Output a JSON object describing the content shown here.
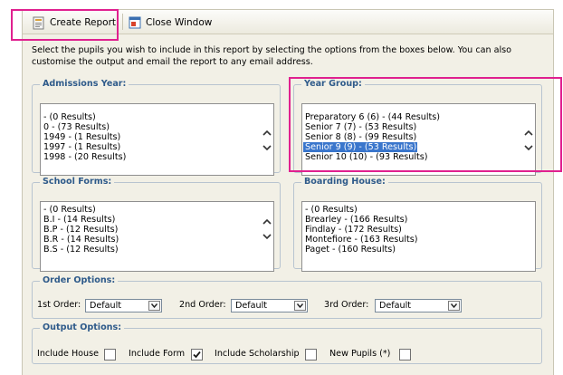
{
  "toolbar": {
    "create_report_label": "Create Report",
    "close_window_label": "Close Window"
  },
  "intro_text": "Select the pupils you wish to include in this report by selecting the options from the boxes below. You can also customise the output and email the report to any email address.",
  "admissions_year": {
    "legend": "Admissions Year:",
    "items": [
      "- (0 Results)",
      "0 - (73 Results)",
      "1949 - (1 Results)",
      "1997 - (1 Results)",
      "1998 - (20 Results)"
    ]
  },
  "year_group": {
    "legend": "Year Group:",
    "items": [
      "Preparatory 6 (6) - (44 Results)",
      "Senior 7 (7) - (53 Results)",
      "Senior 8 (8) - (99 Results)",
      "Senior 9 (9) - (53 Results)",
      "Senior 10 (10) - (93 Results)"
    ],
    "selected": "Senior 9 (9) - (53 Results)"
  },
  "school_forms": {
    "legend": "School Forms:",
    "items": [
      "- (0 Results)",
      "B.I - (14 Results)",
      "B.P - (12 Results)",
      "B.R - (14 Results)",
      "B.S - (12 Results)"
    ]
  },
  "boarding_house": {
    "legend": "Boarding House:",
    "items": [
      "- (0 Results)",
      "Brearley - (166 Results)",
      "Findlay - (172 Results)",
      "Montefiore - (163 Results)",
      "Paget - (160 Results)"
    ]
  },
  "order_options": {
    "legend": "Order Options:",
    "first_label": "1st Order:",
    "first_value": "Default",
    "second_label": "2nd Order:",
    "second_value": "Default",
    "third_label": "3rd Order:",
    "third_value": "Default"
  },
  "output_options": {
    "legend": "Output Options:",
    "include_house_label": "Include House",
    "include_house_checked": false,
    "include_form_label": "Include Form",
    "include_form_checked": true,
    "include_scholarship_label": "Include Scholarship",
    "include_scholarship_checked": false,
    "new_pupils_label": "New Pupils (*)",
    "new_pupils_checked": false
  },
  "icons": {
    "create_report": "report-icon",
    "close_window": "close-window-icon",
    "scroll_up": "chevron-up-icon",
    "scroll_down": "chevron-down-icon",
    "dropdown": "dropdown-arrow-icon",
    "checkmark": "checkmark-icon"
  },
  "colors": {
    "legend_text": "#2e5a8a",
    "selection": "#3a76cc",
    "highlight": "#e0208f",
    "panel_background": "#f2f0e6"
  }
}
